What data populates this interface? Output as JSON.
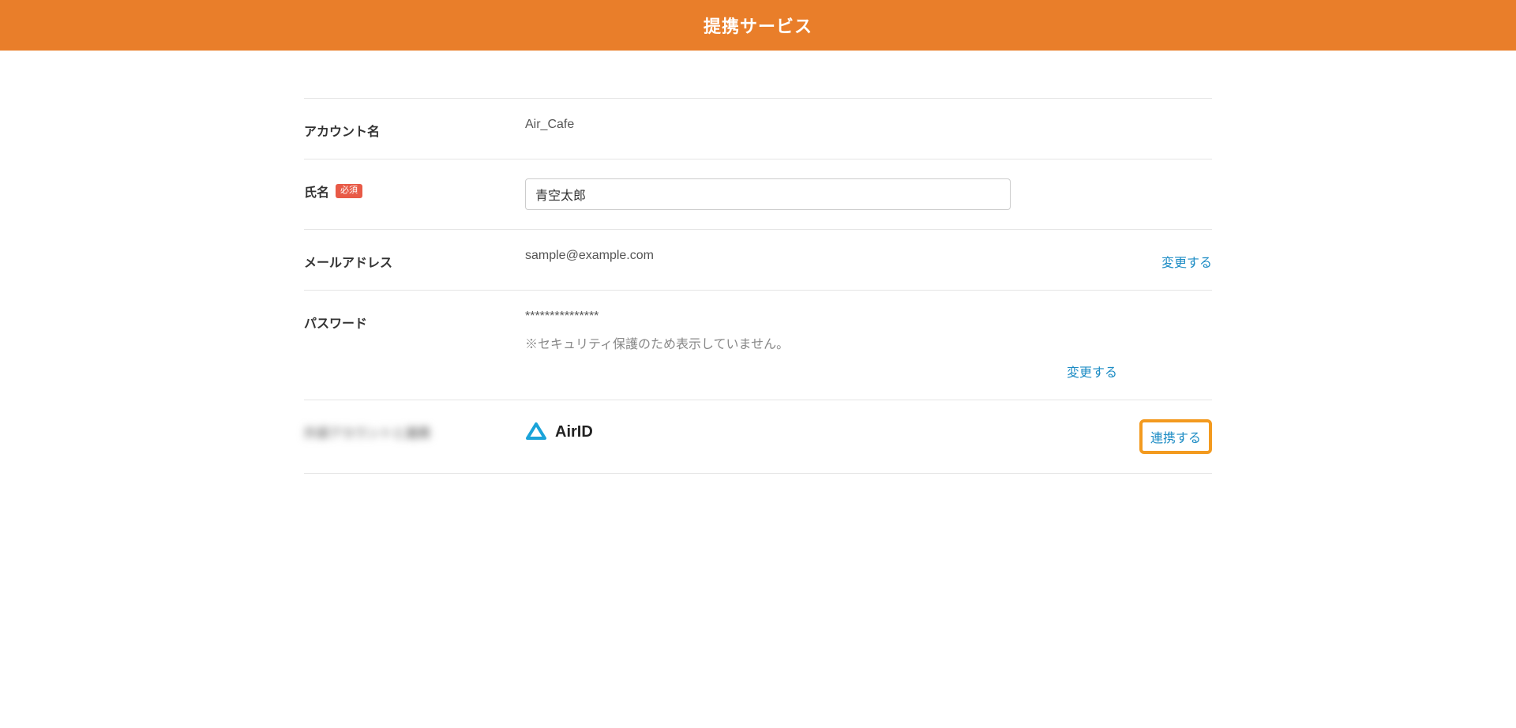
{
  "header": {
    "title": "提携サービス"
  },
  "fields": {
    "account_name": {
      "label": "アカウント名",
      "value": "Air_Cafe"
    },
    "name": {
      "label": "氏名",
      "required_badge": "必須",
      "value": "青空太郎"
    },
    "email": {
      "label": "メールアドレス",
      "value": "sample@example.com",
      "change": "変更する"
    },
    "password": {
      "label": "パスワード",
      "masked": "***************",
      "note": "※セキュリティ保護のため表示していません。",
      "change": "変更する"
    },
    "external_account": {
      "label": "外部アカウントと連携",
      "service": "AirID",
      "link_action": "連携する"
    }
  }
}
